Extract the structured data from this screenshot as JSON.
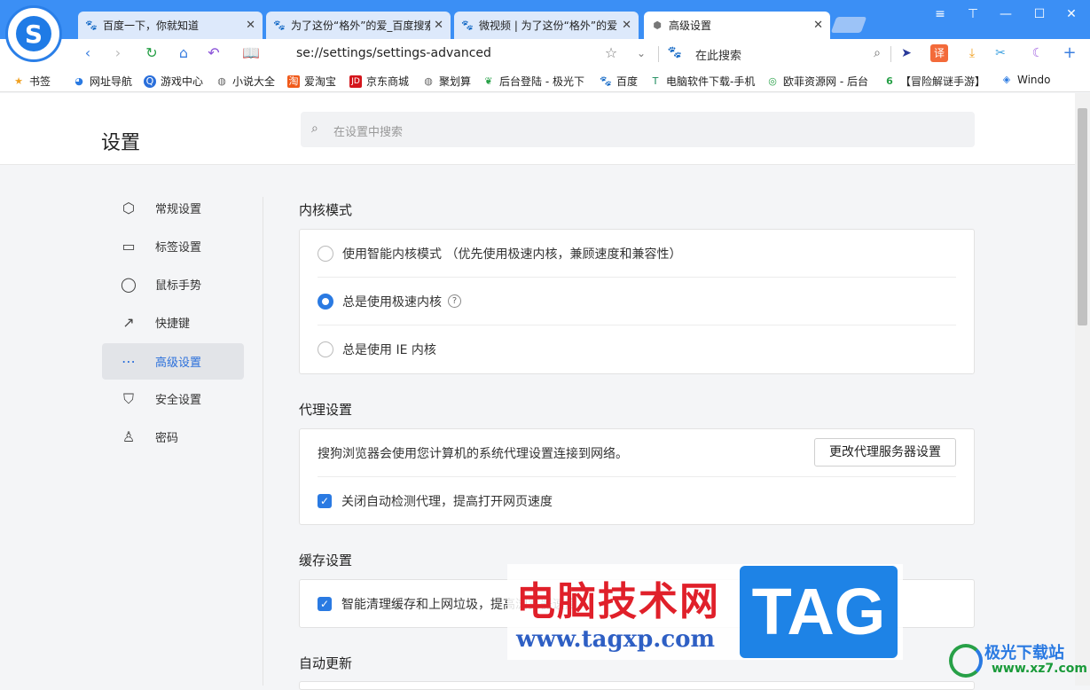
{
  "browser": {
    "tabs": [
      {
        "label": "百度一下，你就知道",
        "icon": "baidu-icon"
      },
      {
        "label": "为了这份“格外”的爱_百度搜索",
        "icon": "baidu-icon"
      },
      {
        "label": "微视频 | 为了这份“格外”的爱",
        "icon": "baidu-icon"
      },
      {
        "label": "高级设置",
        "icon": "gear-icon"
      }
    ],
    "url": "se://settings/settings-advanced",
    "search_placeholder": "在此搜索",
    "bookmarks": [
      {
        "label": "书签",
        "icon": "star-icon"
      },
      {
        "label": "网址导航",
        "icon": "nav-icon"
      },
      {
        "label": "游戏中心",
        "icon": "game-icon"
      },
      {
        "label": "小说大全",
        "icon": "globe-icon"
      },
      {
        "label": "爱淘宝",
        "icon": "taobao-icon"
      },
      {
        "label": "京东商城",
        "icon": "jd-icon"
      },
      {
        "label": "聚划算",
        "icon": "globe-icon"
      },
      {
        "label": "后台登陆 - 极光下",
        "icon": "leaf-icon"
      },
      {
        "label": "百度",
        "icon": "baidu-icon"
      },
      {
        "label": "电脑软件下载-手机",
        "icon": "software-icon"
      },
      {
        "label": "欧菲资源网 - 后台",
        "icon": "resource-icon"
      },
      {
        "label": "【冒险解谜手游】",
        "icon": "game6-icon"
      },
      {
        "label": "Windo",
        "icon": "windows-icon"
      }
    ]
  },
  "settings": {
    "title": "设置",
    "search_placeholder": "在设置中搜索",
    "nav": [
      {
        "label": "常规设置",
        "icon": "gear-outline-icon"
      },
      {
        "label": "标签设置",
        "icon": "tab-icon"
      },
      {
        "label": "鼠标手势",
        "icon": "mouse-icon"
      },
      {
        "label": "快捷键",
        "icon": "shortcut-icon"
      },
      {
        "label": "高级设置",
        "icon": "more-icon",
        "active": true
      },
      {
        "label": "安全设置",
        "icon": "shield-icon"
      },
      {
        "label": "密码",
        "icon": "user-icon"
      }
    ],
    "kernel": {
      "title": "内核模式",
      "options": [
        {
          "label": "使用智能内核模式 （优先使用极速内核，兼顾速度和兼容性）",
          "selected": false
        },
        {
          "label": "总是使用极速内核",
          "selected": true,
          "help": "?"
        },
        {
          "label": "总是使用 IE 内核",
          "selected": false
        }
      ]
    },
    "proxy": {
      "title": "代理设置",
      "description": "搜狗浏览器会使用您计算机的系统代理设置连接到网络。",
      "button": "更改代理服务器设置",
      "checkbox": {
        "label": "关闭自动检测代理，提高打开网页速度",
        "checked": true
      }
    },
    "cache": {
      "title": "缓存设置",
      "checkbox": {
        "label": "智能清理缓存和上网垃圾，提高浏览器速度",
        "checked": true
      }
    },
    "update": {
      "title": "自动更新"
    }
  },
  "watermark": {
    "cn": "电脑技术网",
    "url": "www.tagxp.com",
    "tag": "TAG",
    "site2": "极光下载站",
    "site2_url": "www.xz7.com"
  },
  "colors": {
    "titlebar": "#3b8ff5",
    "accent": "#2a7ae2"
  }
}
